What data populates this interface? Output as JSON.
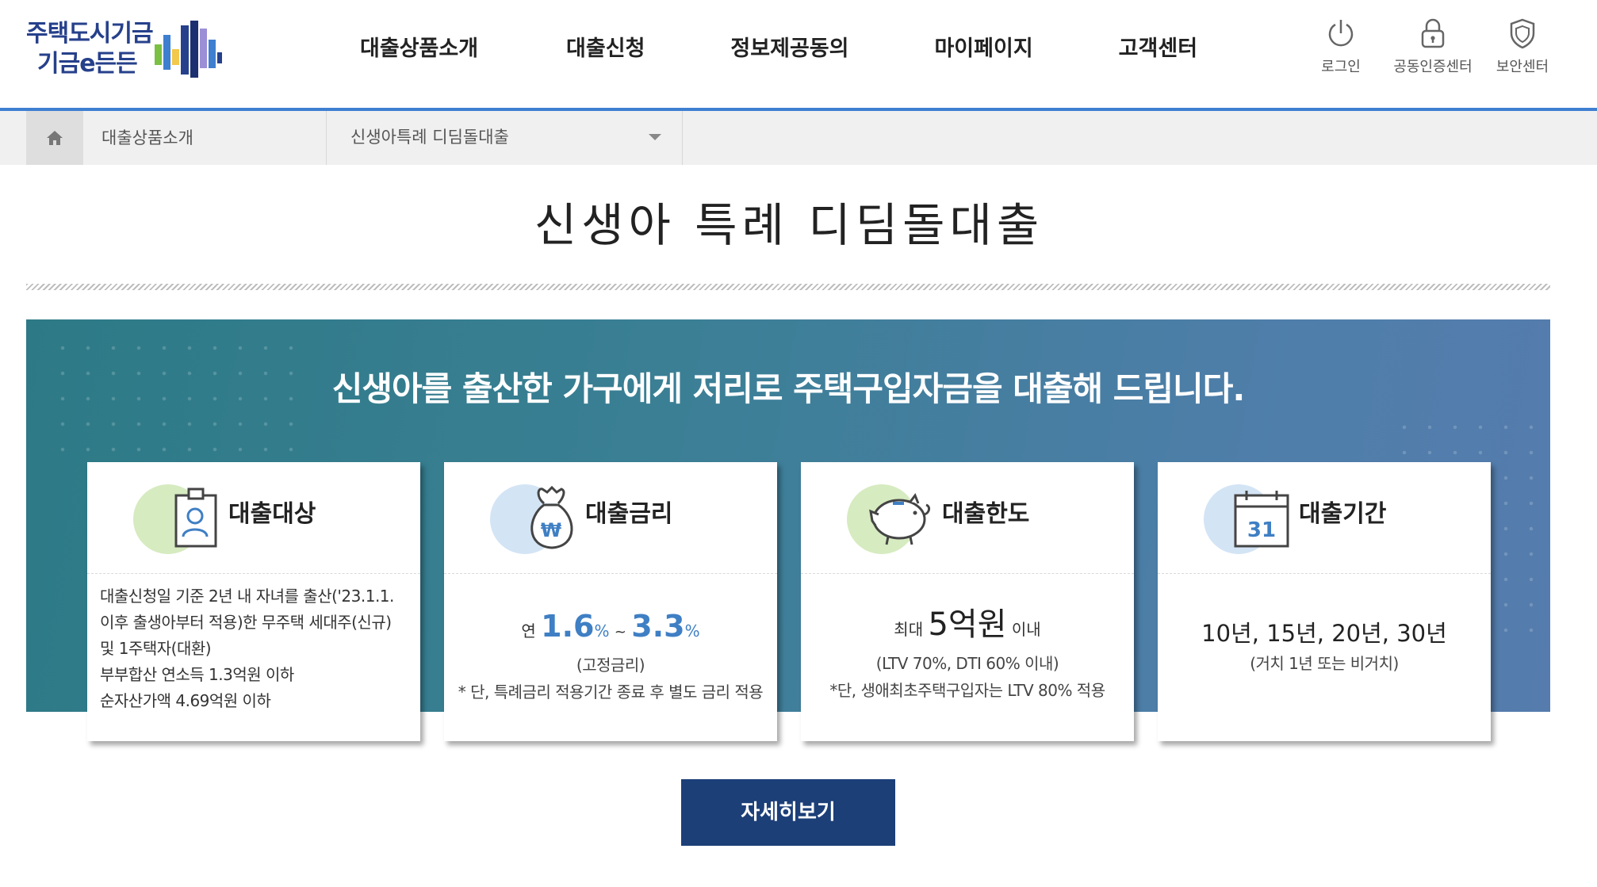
{
  "header": {
    "logo": {
      "line1": "주택도시기금",
      "line2": "기금e든든"
    },
    "nav": [
      "대출상품소개",
      "대출신청",
      "정보제공동의",
      "마이페이지",
      "고객센터"
    ],
    "utility": [
      {
        "label": "로그인",
        "icon": "power-icon"
      },
      {
        "label": "공동인증센터",
        "icon": "lock-icon"
      },
      {
        "label": "보안센터",
        "icon": "shield-icon"
      }
    ],
    "accent_color": "#3f7fd0"
  },
  "breadcrumb": {
    "home_icon": "home-icon",
    "level1": "대출상품소개",
    "level2": "신생아특례 디딤돌대출"
  },
  "page": {
    "title": "신생아 특례 디딤돌대출",
    "headline": "신생아를 출산한 가구에게 저리로 주택구입자금을 대출해 드립니다."
  },
  "cards": {
    "target": {
      "title": "대출대상",
      "icon": "id-badge-icon",
      "lines": [
        "대출신청일 기준 2년 내 자녀를 출산('23.1.1.",
        "이후 출생아부터 적용)한 무주택 세대주(신규)",
        "및 1주택자(대환)",
        "부부합산 연소득 1.3억원 이하",
        "순자산가액 4.69억원 이하"
      ]
    },
    "rate": {
      "title": "대출금리",
      "icon": "money-bag-icon",
      "prefix": "연",
      "min": "1.6",
      "unit": "%",
      "separator": "~",
      "max": "3.3",
      "type": "(고정금리)",
      "note": "* 단, 특례금리 적용기간 종료 후 별도 금리 적용"
    },
    "limit": {
      "title": "대출한도",
      "icon": "piggy-bank-icon",
      "prefix": "최대",
      "amount": "5억원",
      "suffix": "이내",
      "condition": "(LTV 70%, DTI 60% 이내)",
      "note": "*단, 생애최초주택구입자는 LTV 80% 적용"
    },
    "period": {
      "title": "대출기간",
      "icon": "calendar-icon",
      "calendar_day": "31",
      "terms": "10년, 15년, 20년, 30년",
      "note": "(거치 1년 또는 비거치)"
    }
  },
  "detail_button": "자세히보기",
  "colors": {
    "banner_start": "#2d7a86",
    "banner_end": "#557cad",
    "button": "#1c3f78",
    "rate_blue": "#3f7fc4"
  }
}
